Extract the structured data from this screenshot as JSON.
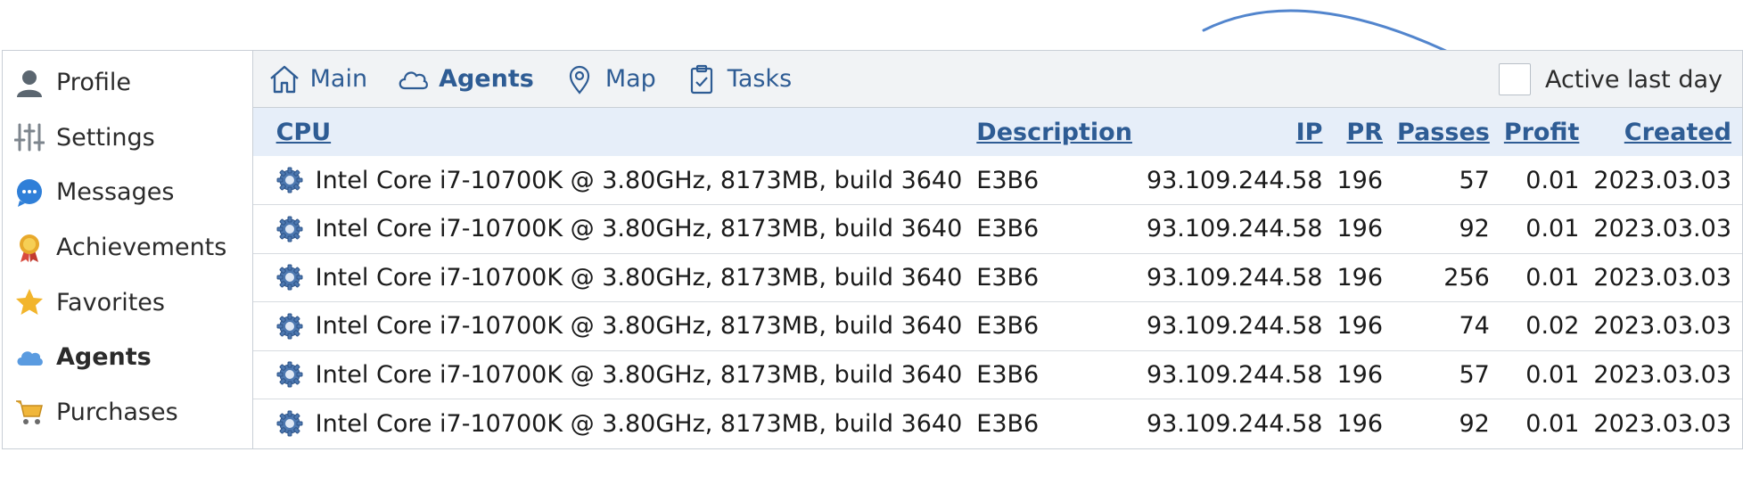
{
  "sidebar": {
    "items": [
      {
        "label": "Profile",
        "icon": "user-icon",
        "active": false
      },
      {
        "label": "Settings",
        "icon": "sliders-icon",
        "active": false
      },
      {
        "label": "Messages",
        "icon": "chat-icon",
        "active": false
      },
      {
        "label": "Achievements",
        "icon": "medal-icon",
        "active": false
      },
      {
        "label": "Favorites",
        "icon": "star-icon",
        "active": false
      },
      {
        "label": "Agents",
        "icon": "cloud-icon",
        "active": true
      },
      {
        "label": "Purchases",
        "icon": "cart-icon",
        "active": false
      }
    ]
  },
  "topnav": {
    "items": [
      {
        "label": "Main",
        "icon": "home-icon",
        "active": false
      },
      {
        "label": "Agents",
        "icon": "cloud-outline-icon",
        "active": true
      },
      {
        "label": "Map",
        "icon": "map-pin-icon",
        "active": false
      },
      {
        "label": "Tasks",
        "icon": "clipboard-icon",
        "active": false
      }
    ],
    "filter_label": "Active last day",
    "filter_checked": false
  },
  "table": {
    "columns": [
      "CPU",
      "Description",
      "IP",
      "PR",
      "Passes",
      "Profit",
      "Created"
    ],
    "rows": [
      {
        "cpu": "Intel Core i7-10700K @ 3.80GHz, 8173MB, build 3640",
        "description": "E3B6",
        "ip": "93.109.244.58",
        "pr": "196",
        "passes": "57",
        "profit": "0.01",
        "created": "2023.03.03"
      },
      {
        "cpu": "Intel Core i7-10700K @ 3.80GHz, 8173MB, build 3640",
        "description": "E3B6",
        "ip": "93.109.244.58",
        "pr": "196",
        "passes": "92",
        "profit": "0.01",
        "created": "2023.03.03"
      },
      {
        "cpu": "Intel Core i7-10700K @ 3.80GHz, 8173MB, build 3640",
        "description": "E3B6",
        "ip": "93.109.244.58",
        "pr": "196",
        "passes": "256",
        "profit": "0.01",
        "created": "2023.03.03"
      },
      {
        "cpu": "Intel Core i7-10700K @ 3.80GHz, 8173MB, build 3640",
        "description": "E3B6",
        "ip": "93.109.244.58",
        "pr": "196",
        "passes": "74",
        "profit": "0.02",
        "created": "2023.03.03"
      },
      {
        "cpu": "Intel Core i7-10700K @ 3.80GHz, 8173MB, build 3640",
        "description": "E3B6",
        "ip": "93.109.244.58",
        "pr": "196",
        "passes": "57",
        "profit": "0.01",
        "created": "2023.03.03"
      },
      {
        "cpu": "Intel Core i7-10700K @ 3.80GHz, 8173MB, build 3640",
        "description": "E3B6",
        "ip": "93.109.244.58",
        "pr": "196",
        "passes": "92",
        "profit": "0.01",
        "created": "2023.03.03"
      }
    ]
  },
  "colors": {
    "accent": "#2e5c94",
    "header_bg": "#e6eef9",
    "nav_bg": "#f1f3f5",
    "arrow": "#3f78c8"
  }
}
